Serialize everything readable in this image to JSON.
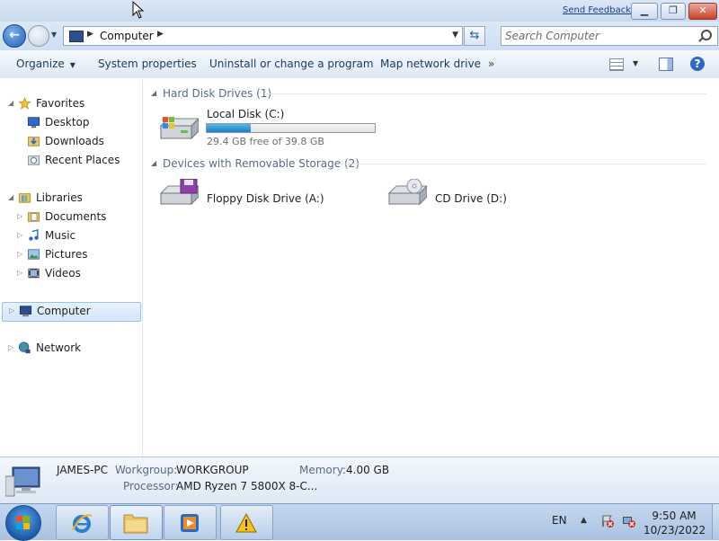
{
  "titlebar": {
    "feedback_link": "Send Feedback",
    "buttons": [
      "minimize",
      "restore",
      "close"
    ]
  },
  "address_bar": {
    "path": [
      "Computer"
    ],
    "icon": "computer-icon",
    "search_placeholder": "Search Computer"
  },
  "toolbar": {
    "organize": "Organize",
    "system_properties": "System properties",
    "uninstall": "Uninstall or change a program",
    "map_network_drive": "Map network drive",
    "more": "»"
  },
  "navigation": {
    "favorites": {
      "label": "Favorites",
      "items": [
        "Desktop",
        "Downloads",
        "Recent Places"
      ]
    },
    "libraries": {
      "label": "Libraries",
      "items": [
        "Documents",
        "Music",
        "Pictures",
        "Videos"
      ]
    },
    "computer": {
      "label": "Computer",
      "selected": true
    },
    "network": {
      "label": "Network"
    }
  },
  "content": {
    "hard_disk_group": "Hard Disk Drives (1)",
    "removable_group": "Devices with Removable Storage (2)",
    "drives": {
      "c": {
        "name": "Local Disk (C:)",
        "free_text": "29.4 GB free of 39.8 GB",
        "used_fraction": 0.26
      },
      "a": {
        "name": "Floppy Disk Drive (A:)"
      },
      "d": {
        "name": "CD Drive (D:)"
      }
    }
  },
  "details": {
    "computer_name": "JAMES-PC",
    "workgroup_label": "Workgroup:",
    "workgroup": "WORKGROUP",
    "memory_label": "Memory:",
    "memory": "4.00 GB",
    "processor_label": "Processor:",
    "processor": "AMD Ryzen 7 5800X 8-C..."
  },
  "taskbar": {
    "apps": [
      "internet-explorer",
      "windows-explorer",
      "media-player",
      "warning-app"
    ],
    "language": "EN",
    "time": "9:50 AM",
    "date": "10/23/2022"
  },
  "colors": {
    "accent": "#1b7fc4",
    "toolbar_text": "#1e395b",
    "selection": "#d3e6fb"
  }
}
